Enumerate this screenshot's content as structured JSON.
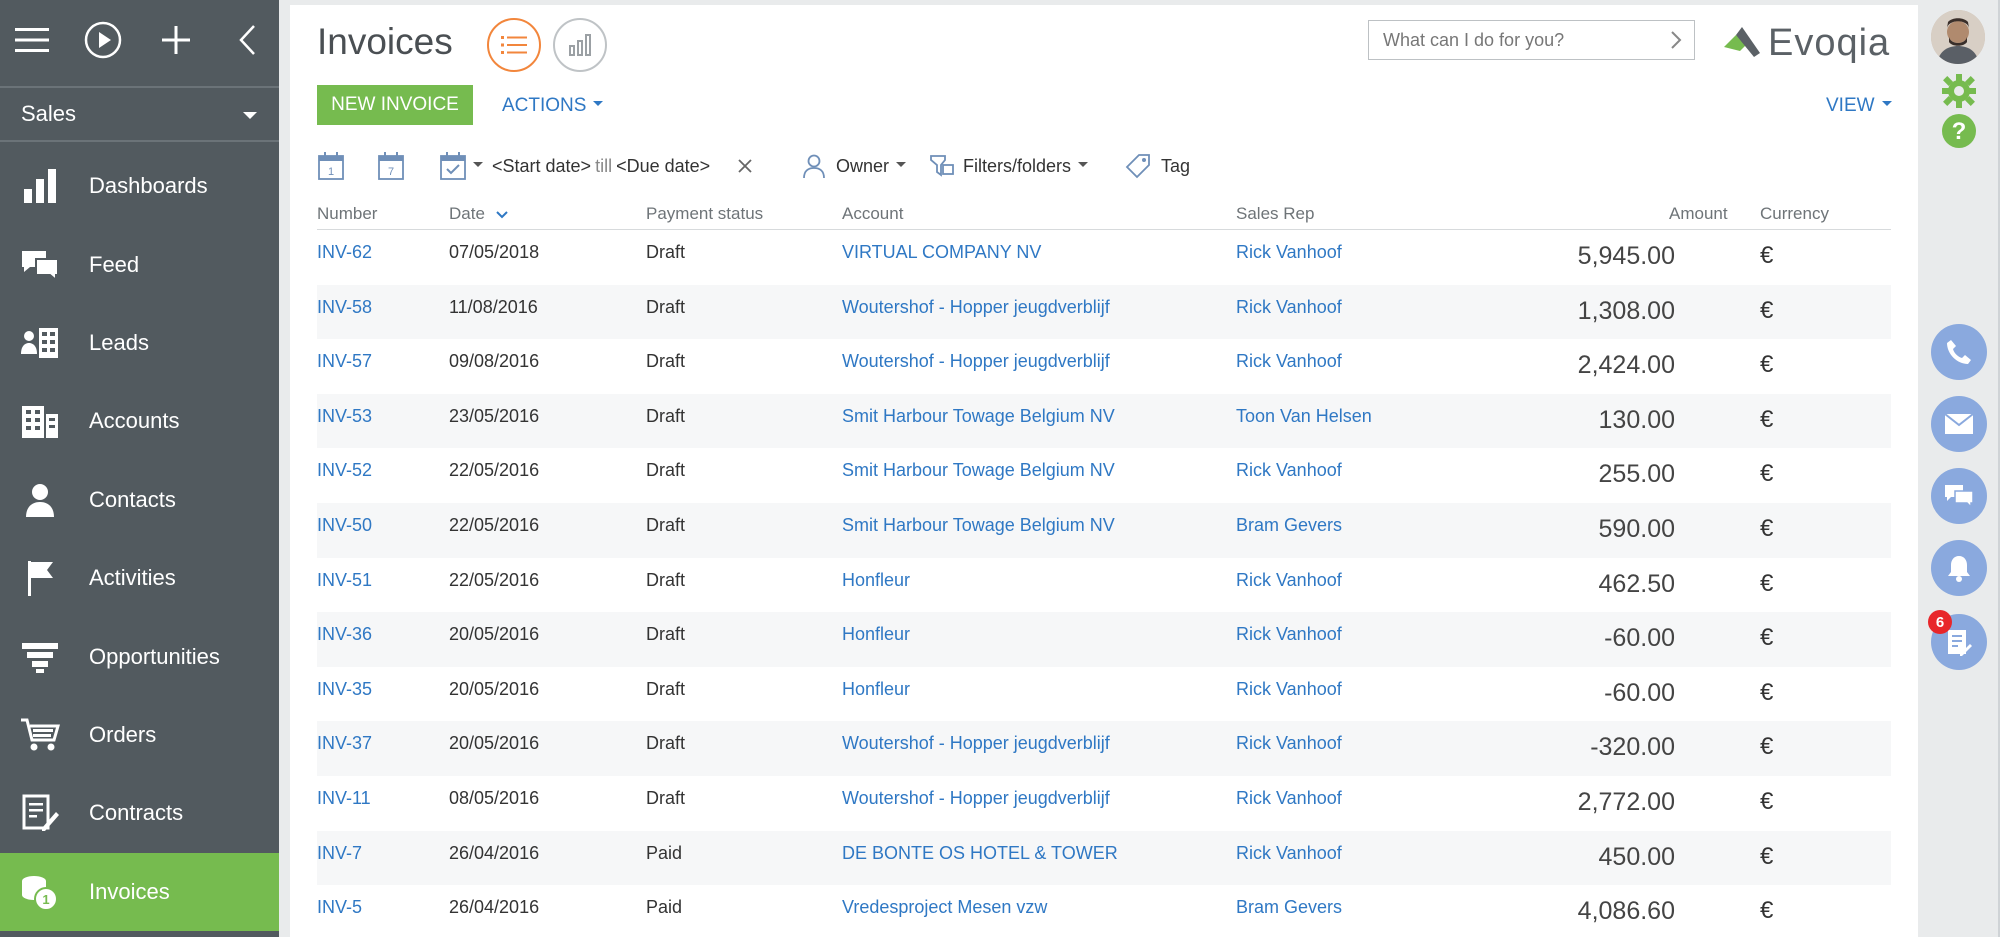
{
  "sidebar": {
    "section": "Sales",
    "items": [
      {
        "label": "Dashboards",
        "icon": "dashboards-icon"
      },
      {
        "label": "Feed",
        "icon": "feed-icon"
      },
      {
        "label": "Leads",
        "icon": "leads-icon"
      },
      {
        "label": "Accounts",
        "icon": "accounts-icon"
      },
      {
        "label": "Contacts",
        "icon": "contacts-icon"
      },
      {
        "label": "Activities",
        "icon": "activities-icon"
      },
      {
        "label": "Opportunities",
        "icon": "opportunities-icon"
      },
      {
        "label": "Orders",
        "icon": "orders-icon"
      },
      {
        "label": "Contracts",
        "icon": "contracts-icon"
      },
      {
        "label": "Invoices",
        "icon": "invoices-icon",
        "active": true
      }
    ]
  },
  "header": {
    "title": "Invoices",
    "search_placeholder": "What can I do for you?",
    "logo_text": "Evoqia"
  },
  "toolbar": {
    "new_invoice": "NEW INVOICE",
    "actions": "ACTIONS",
    "view": "VIEW"
  },
  "filters": {
    "start_date": "<Start date>",
    "till": "till",
    "due_date": "<Due date>",
    "owner": "Owner",
    "filters_folders": "Filters/folders",
    "tag": "Tag"
  },
  "table": {
    "columns": [
      "Number",
      "Date",
      "Payment status",
      "Account",
      "Sales Rep",
      "Amount",
      "Currency"
    ],
    "rows": [
      {
        "number": "INV-62",
        "date": "07/05/2018",
        "status": "Draft",
        "account": "VIRTUAL COMPANY NV",
        "rep": "Rick Vanhoof",
        "amount": "5,945.00",
        "currency": "€"
      },
      {
        "number": "INV-58",
        "date": "11/08/2016",
        "status": "Draft",
        "account": "Woutershof - Hopper jeugdverblijf",
        "rep": "Rick Vanhoof",
        "amount": "1,308.00",
        "currency": "€"
      },
      {
        "number": "INV-57",
        "date": "09/08/2016",
        "status": "Draft",
        "account": "Woutershof - Hopper jeugdverblijf",
        "rep": "Rick Vanhoof",
        "amount": "2,424.00",
        "currency": "€"
      },
      {
        "number": "INV-53",
        "date": "23/05/2016",
        "status": "Draft",
        "account": "Smit Harbour Towage Belgium NV",
        "rep": "Toon Van Helsen",
        "amount": "130.00",
        "currency": "€"
      },
      {
        "number": "INV-52",
        "date": "22/05/2016",
        "status": "Draft",
        "account": "Smit Harbour Towage Belgium NV",
        "rep": "Rick Vanhoof",
        "amount": "255.00",
        "currency": "€"
      },
      {
        "number": "INV-50",
        "date": "22/05/2016",
        "status": "Draft",
        "account": "Smit Harbour Towage Belgium NV",
        "rep": "Bram Gevers",
        "amount": "590.00",
        "currency": "€"
      },
      {
        "number": "INV-51",
        "date": "22/05/2016",
        "status": "Draft",
        "account": "Honfleur",
        "rep": "Rick Vanhoof",
        "amount": "462.50",
        "currency": "€"
      },
      {
        "number": "INV-36",
        "date": "20/05/2016",
        "status": "Draft",
        "account": "Honfleur",
        "rep": "Rick Vanhoof",
        "amount": "-60.00",
        "currency": "€"
      },
      {
        "number": "INV-35",
        "date": "20/05/2016",
        "status": "Draft",
        "account": "Honfleur",
        "rep": "Rick Vanhoof",
        "amount": "-60.00",
        "currency": "€"
      },
      {
        "number": "INV-37",
        "date": "20/05/2016",
        "status": "Draft",
        "account": "Woutershof - Hopper jeugdverblijf",
        "rep": "Rick Vanhoof",
        "amount": "-320.00",
        "currency": "€"
      },
      {
        "number": "INV-11",
        "date": "08/05/2016",
        "status": "Draft",
        "account": "Woutershof - Hopper jeugdverblijf",
        "rep": "Rick Vanhoof",
        "amount": "2,772.00",
        "currency": "€"
      },
      {
        "number": "INV-7",
        "date": "26/04/2016",
        "status": "Paid",
        "account": "DE BONTE OS HOTEL & TOWER",
        "rep": "Rick Vanhoof",
        "amount": "450.00",
        "currency": "€"
      },
      {
        "number": "INV-5",
        "date": "26/04/2016",
        "status": "Paid",
        "account": "Vredesproject Mesen vzw",
        "rep": "Bram Gevers",
        "amount": "4,086.60",
        "currency": "€"
      }
    ]
  },
  "rightbar": {
    "notification_count": "6"
  },
  "colors": {
    "sidebar": "#525a5f",
    "accent_green": "#76bb4f",
    "link_blue": "#2f78c4",
    "orange": "#f2863c",
    "action_blue": "#8aa9de",
    "badge_red": "#e8262a"
  }
}
